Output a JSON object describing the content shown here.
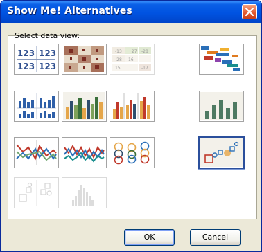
{
  "window": {
    "title": "Show Me! Alternatives",
    "close_icon": "close-icon"
  },
  "prompt": "Select data view:",
  "text_table": {
    "values": [
      "123",
      "123",
      "123",
      "123"
    ]
  },
  "highlight_table": {
    "values": [
      "-13",
      "+27",
      "-28",
      "-28",
      "16",
      "",
      "15",
      "",
      "-17"
    ]
  },
  "selected_view": "circle-view",
  "buttons": {
    "ok": "OK",
    "cancel": "Cancel"
  },
  "colors": {
    "titlebar": "#0053e1",
    "selection": "#2b4f9c",
    "close": "#e3582e"
  }
}
